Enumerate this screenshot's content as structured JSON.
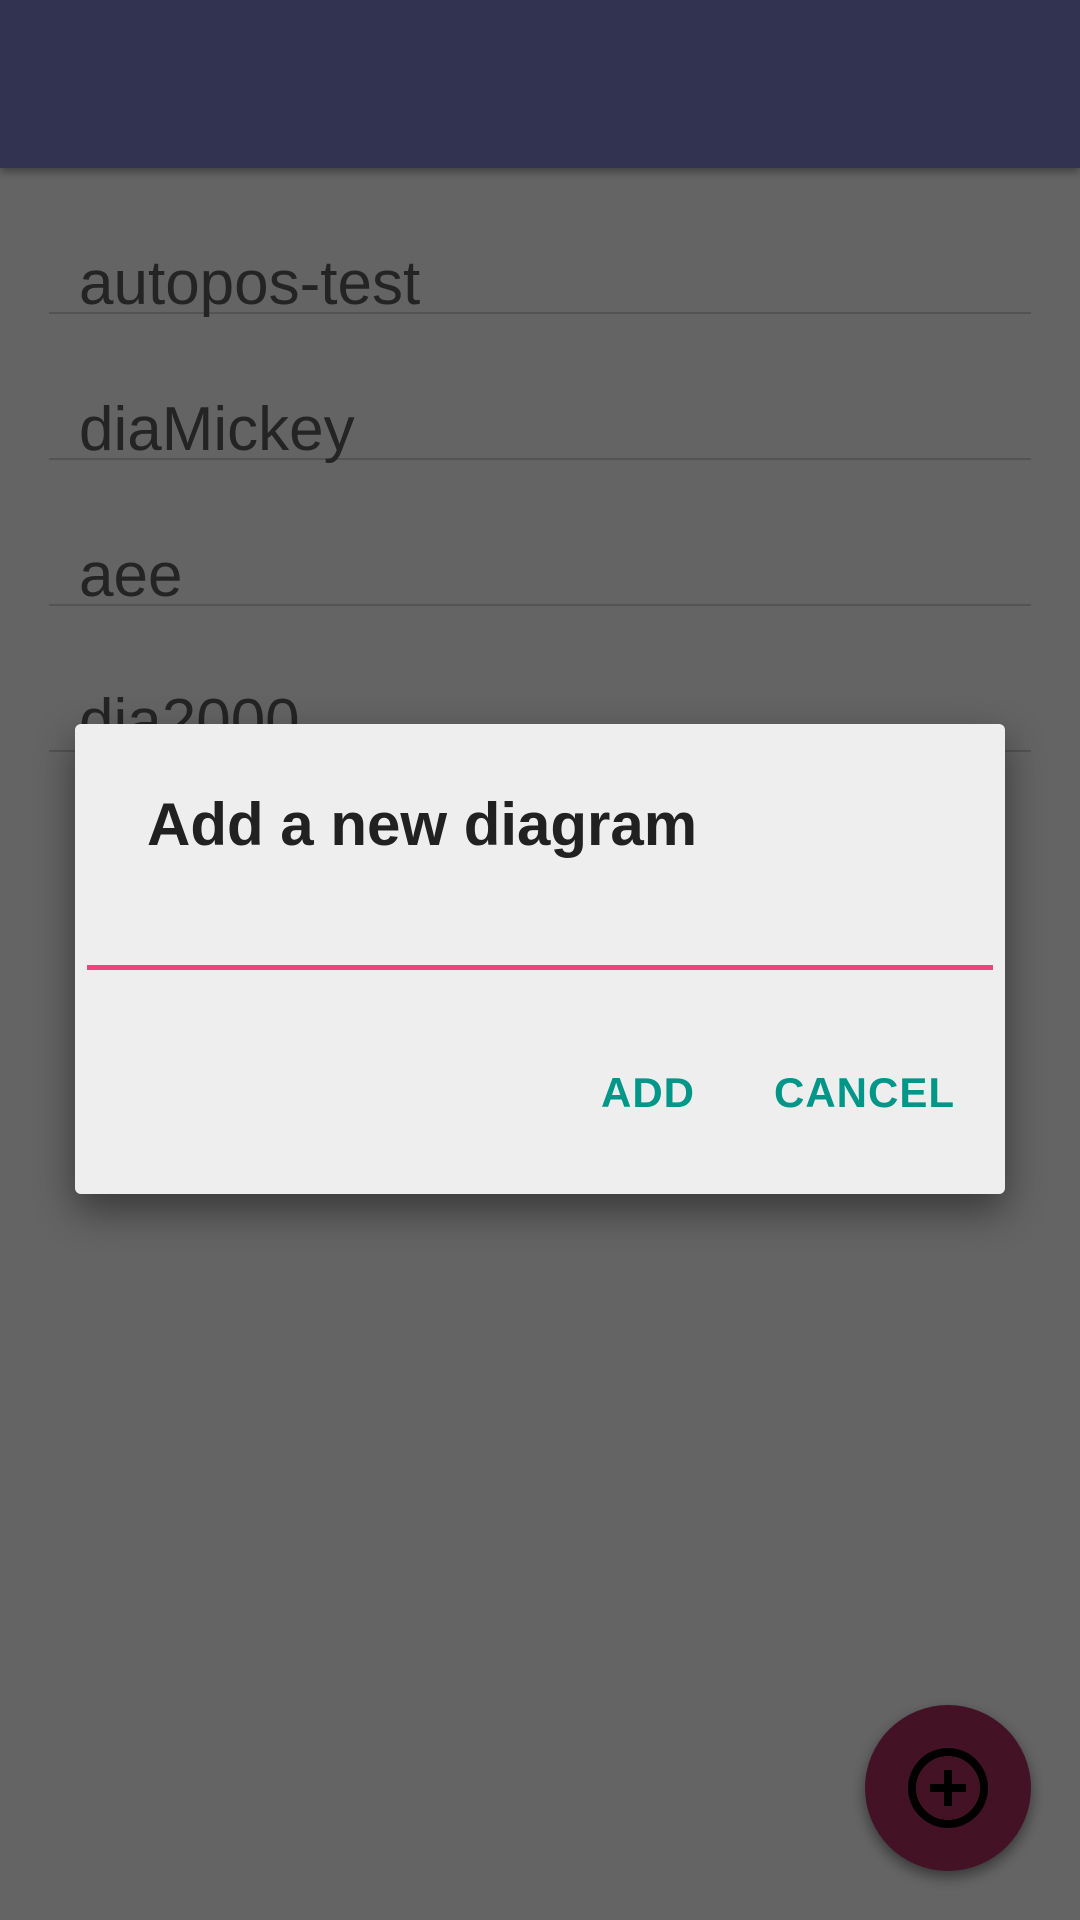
{
  "app_bar": {
    "color": "#7b7fc8"
  },
  "diagrams": [
    {
      "label": "autopos-test"
    },
    {
      "label": "diaMickey"
    },
    {
      "label": "aee"
    },
    {
      "label": "dia2000"
    }
  ],
  "dialog": {
    "title": "Add a new diagram",
    "input_value": "",
    "add_label": "ADD",
    "cancel_label": "CANCEL"
  },
  "fab": {
    "icon": "add-circle-icon",
    "color": "#a8315c"
  },
  "colors": {
    "accent": "#e8467c",
    "button_text": "#009688"
  }
}
